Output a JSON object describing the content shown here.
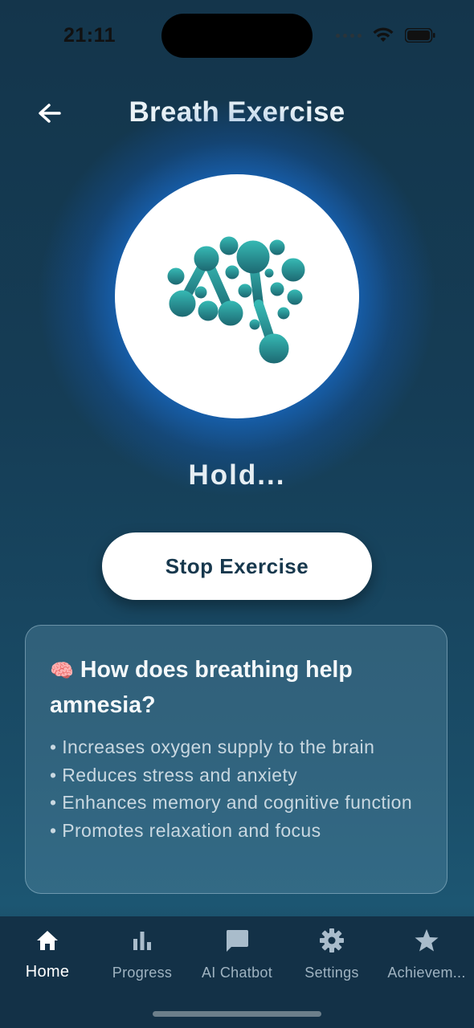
{
  "status_bar": {
    "time": "21:11"
  },
  "header": {
    "title": "Breath Exercise",
    "back_icon": "arrow-left-icon"
  },
  "exercise": {
    "phase": "Hold...",
    "stop_label": "Stop Exercise",
    "logo": "ai-brain-logo"
  },
  "info_card": {
    "icon": "🧠",
    "title": "How does breathing help amnesia?",
    "items": [
      "• Increases oxygen supply to the brain",
      "• Reduces stress and anxiety",
      "• Enhances memory and cognitive function",
      "• Promotes relaxation and focus"
    ]
  },
  "bottom_nav": {
    "items": [
      {
        "label": "Home",
        "icon": "home-icon",
        "active": true
      },
      {
        "label": "Progress",
        "icon": "bar-chart-icon",
        "active": false
      },
      {
        "label": "AI Chatbot",
        "icon": "chat-icon",
        "active": false
      },
      {
        "label": "Settings",
        "icon": "gear-icon",
        "active": false
      },
      {
        "label": "Achievem...",
        "icon": "star-icon",
        "active": false
      }
    ]
  },
  "colors": {
    "background_top": "#14354b",
    "background_bottom": "#1c5672",
    "glow": "#2896ff",
    "logo_teal": "#2aa6a6",
    "nav_background": "#133147",
    "button_text": "#17384d"
  }
}
